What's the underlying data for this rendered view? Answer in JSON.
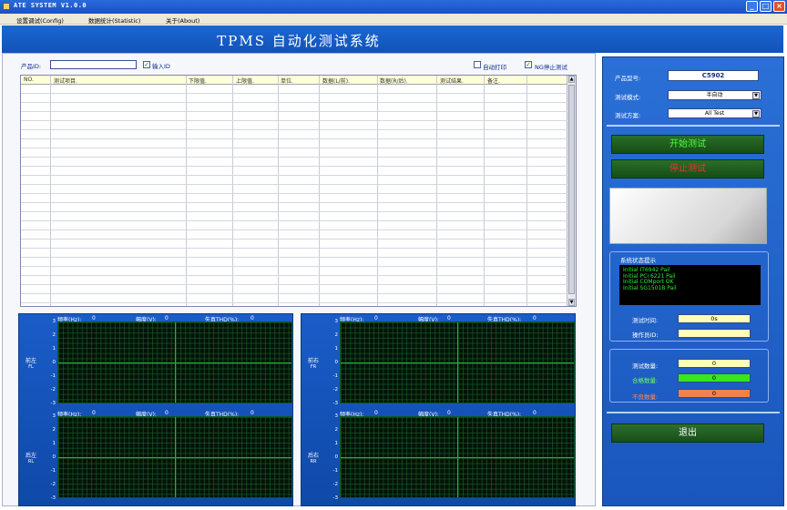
{
  "window": {
    "title": "ATE SYSTEM V1.0.0"
  },
  "menu": {
    "config": "设置调试(Config)",
    "statistic": "数据统计(Statistic)",
    "about": "关于(About)"
  },
  "banner": {
    "title": "TPMS 自动化测试系统"
  },
  "top_controls": {
    "product_id_label": "产品ID:",
    "product_id_value": "",
    "input_id_label": "输入ID",
    "input_id_checked": true,
    "auto_print_label": "自动打印",
    "auto_print_checked": false,
    "ng_stop_label": "NG停止测试",
    "ng_stop_checked": true
  },
  "table": {
    "columns": [
      "NO.",
      "测试项目.",
      "下限值.",
      "上限值.",
      "单位.",
      "数据(L/前).",
      "数据(R/后).",
      "测试结果.",
      "备注."
    ],
    "rows": []
  },
  "charts": [
    {
      "channel_cn": "前左",
      "channel_code": "FL",
      "freq_label": "频率(Hz):",
      "freq_value": "0",
      "amp_label": "幅度(V):",
      "amp_value": "0",
      "thd_label": "失真THD(%):",
      "thd_value": "0",
      "yticks": [
        "3",
        "2",
        "1",
        "0",
        "-1",
        "-2",
        "-3"
      ]
    },
    {
      "channel_cn": "前右",
      "channel_code": "FR",
      "freq_label": "频率(Hz):",
      "freq_value": "0",
      "amp_label": "幅度(V):",
      "amp_value": "0",
      "thd_label": "失真THD(%):",
      "thd_value": "0",
      "yticks": [
        "3",
        "2",
        "1",
        "0",
        "-1",
        "-2",
        "-3"
      ]
    },
    {
      "channel_cn": "后左",
      "channel_code": "RL",
      "freq_label": "频率(Hz):",
      "freq_value": "0",
      "amp_label": "幅度(V):",
      "amp_value": "0",
      "thd_label": "失真THD(%):",
      "thd_value": "0",
      "yticks": [
        "3",
        "2",
        "1",
        "0",
        "-1",
        "-2",
        "-3"
      ]
    },
    {
      "channel_cn": "后右",
      "channel_code": "RR",
      "freq_label": "频率(Hz):",
      "freq_value": "0",
      "amp_label": "幅度(V):",
      "amp_value": "0",
      "thd_label": "失真THD(%):",
      "thd_value": "0",
      "yticks": [
        "3",
        "2",
        "1",
        "0",
        "-1",
        "-2",
        "-3"
      ]
    }
  ],
  "right": {
    "model_label": "产品型号:",
    "model_value": "C5902",
    "mode_label": "测试模式:",
    "mode_value": "半自动",
    "plan_label": "测试方案:",
    "plan_value": "All Test",
    "start_button": "开始测试",
    "stop_button": "停止测试",
    "status_title": "系统状态提示",
    "status_lines": [
      "Initial IT6942 Pail",
      "Initial PCI 6221 Pail",
      "Initial COMport OK",
      "Initial SG1501B Pail"
    ],
    "test_time_label": "测试时间:",
    "test_time_value": "0s",
    "operator_label": "操作员ID:",
    "operator_value": "",
    "test_count_label": "测试数量:",
    "test_count_value": "0",
    "pass_count_label": "合格数量:",
    "pass_count_value": "0",
    "fail_count_label": "不良数量:",
    "fail_count_value": "0",
    "exit_button": "退出"
  },
  "colors": {
    "panel_blue": "#1a56bd",
    "button_green": "#1f5e1f",
    "start_text": "#4cff3a",
    "stop_text": "#ff2a2a",
    "status_text": "#2ef030",
    "pass_green": "#37e61f",
    "fail_orange": "#f0824a",
    "field_yellow": "#ffffb8"
  }
}
